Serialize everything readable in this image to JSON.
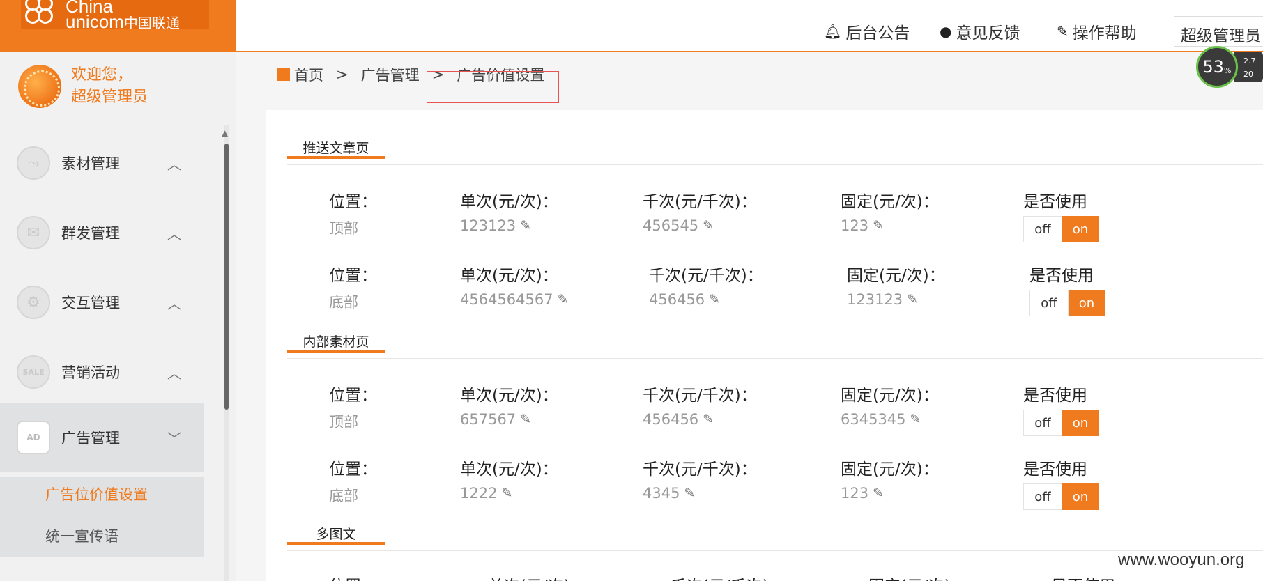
{
  "logo": {
    "text_en_line1": "China",
    "text_en_line2": "unicom",
    "text_cn": "中国联通"
  },
  "header": {
    "announce": "后台公告",
    "feedback": "意见反馈",
    "help": "操作帮助",
    "admin": "超级管理员"
  },
  "widget": {
    "percent": "53",
    "percent_sign": "%",
    "up": "2.7",
    "down": "20"
  },
  "sidebar": {
    "welcome_line1": "欢迎您，",
    "welcome_line2": "超级管理员",
    "items": [
      {
        "label": "素材管理",
        "icon": "chart-icon",
        "expanded": false
      },
      {
        "label": "群发管理",
        "icon": "mail-icon",
        "expanded": false
      },
      {
        "label": "交互管理",
        "icon": "gear-icon",
        "expanded": false
      },
      {
        "label": "营销活动",
        "icon": "sale-icon",
        "expanded": false
      },
      {
        "label": "广告管理",
        "icon": "ad-icon",
        "expanded": true
      }
    ],
    "subitems": [
      {
        "label": "广告位价值设置",
        "current": true
      },
      {
        "label": "统一宣传语",
        "current": false
      }
    ]
  },
  "breadcrumb": {
    "home": "首页",
    "sep": ">",
    "level1": "广告管理",
    "level2": "广告价值设置"
  },
  "labels": {
    "position": "位置：",
    "single": "单次(元/次)：",
    "thousand": "千次(元/千次)：",
    "fixed": "固定(元/次)：",
    "use": "是否使用",
    "off": "off",
    "on": "on"
  },
  "sections": [
    {
      "title": "推送文章页",
      "rows": [
        {
          "position": "顶部",
          "single": "123123",
          "thousand": "456545",
          "fixed": "123",
          "enabled": "on"
        },
        {
          "position": "底部",
          "single": "4564564567",
          "thousand": "456456",
          "fixed": "123123",
          "enabled": "on"
        }
      ]
    },
    {
      "title": "内部素材页",
      "rows": [
        {
          "position": "顶部",
          "single": "657567",
          "thousand": "456456",
          "fixed": "6345345",
          "enabled": "on"
        },
        {
          "position": "底部",
          "single": "1222",
          "thousand": "4345",
          "fixed": "123",
          "enabled": "on"
        }
      ]
    },
    {
      "title": "多图文",
      "rows": []
    }
  ],
  "watermark": "www.wooyun.org",
  "colors": {
    "accent": "#f07a1e",
    "annotation": "#e85454"
  }
}
